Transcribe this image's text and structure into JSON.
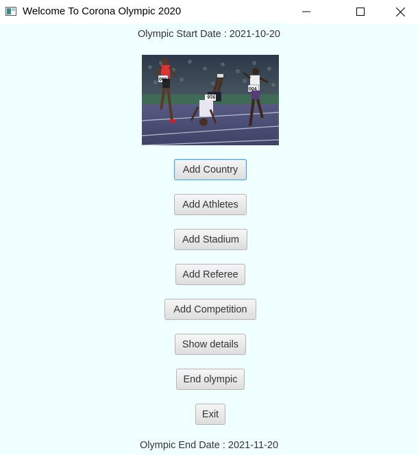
{
  "window": {
    "title": "Welcome To Corona Olympic 2020",
    "controls": [
      "minimize-icon",
      "maximize-icon",
      "close-icon"
    ]
  },
  "main": {
    "start_date": "Olympic Start Date : 2021-10-20",
    "end_date": "Olympic End Date : 2021-11-20",
    "image": {
      "subject": "sprinters on a running track, one athlete doing a backflip",
      "bib_numbers": [
        "009",
        "916",
        "004"
      ]
    },
    "buttons": {
      "add_country": "Add Country",
      "add_athletes": "Add Athletes",
      "add_stadium": "Add Stadium",
      "add_referee": "Add Referee",
      "add_competition": "Add Competition",
      "show_details": "Show details",
      "end_olympic": "End olympic",
      "exit": "Exit"
    },
    "focused_button": "Add Country"
  },
  "colors": {
    "background": "#f0ffff",
    "focus_border": "#3fa4d6",
    "text": "#333333"
  }
}
